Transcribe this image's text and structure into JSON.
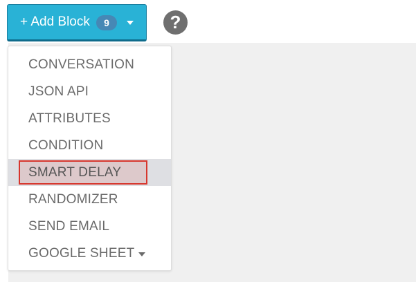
{
  "toolbar": {
    "add_block_label": "+ Add Block",
    "block_count": "9",
    "help_symbol": "?"
  },
  "menu": {
    "items": [
      {
        "label": "CONVERSATION"
      },
      {
        "label": "JSON API"
      },
      {
        "label": "ATTRIBUTES"
      },
      {
        "label": "CONDITION"
      },
      {
        "label": "SMART DELAY",
        "selected": true
      },
      {
        "label": "RANDOMIZER"
      },
      {
        "label": "SEND EMAIL"
      },
      {
        "label": "GOOGLE SHEET",
        "has_submenu": true
      }
    ]
  },
  "colors": {
    "button_bg": "#29b2d6",
    "badge_bg": "#4688b5",
    "highlight_border": "#d7362d",
    "canvas_bg": "#f0f0f0"
  },
  "icons": {
    "add_dropdown": "chevron-down-icon",
    "help": "question-circle-icon"
  }
}
